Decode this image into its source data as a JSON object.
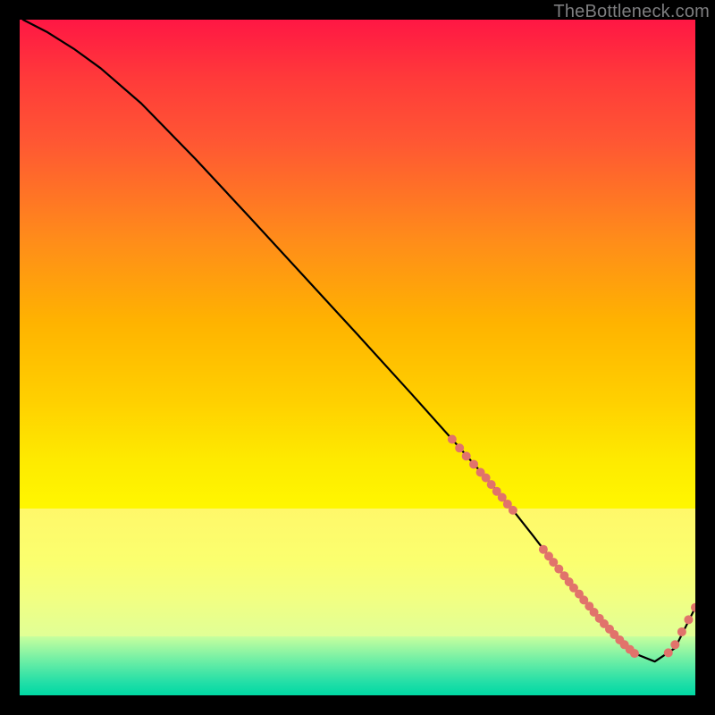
{
  "watermark": "TheBottleneck.com",
  "chart_data": {
    "type": "line",
    "title": "",
    "xlabel": "",
    "ylabel": "",
    "xlim": [
      0,
      100
    ],
    "ylim": [
      0,
      100
    ],
    "grid": false,
    "legend": false,
    "background_bands": [
      {
        "name": "red-yellow-gradient",
        "from_y": 27.7,
        "to_y": 100
      },
      {
        "name": "pale-yellow",
        "from_y": 8.7,
        "to_y": 27.7
      },
      {
        "name": "green-gradient",
        "from_y": 0,
        "to_y": 8.7
      }
    ],
    "series": [
      {
        "name": "bottleneck-curve",
        "color": "#000000",
        "x": [
          0.5,
          4,
          8,
          12,
          18,
          26,
          34,
          42,
          50,
          58,
          64,
          69,
          73,
          76,
          79,
          82,
          85,
          88,
          91,
          94,
          97,
          100
        ],
        "y": [
          100,
          98.2,
          95.7,
          92.8,
          87.6,
          79.4,
          70.8,
          62.1,
          53.4,
          44.6,
          37.9,
          32.2,
          27.4,
          23.6,
          19.7,
          15.9,
          12.3,
          9.0,
          6.2,
          5.0,
          7.0,
          13.0
        ]
      }
    ],
    "dotted_segments": [
      {
        "name": "descent-dots",
        "color": "#e1736b",
        "radius_px": 5,
        "points": [
          [
            64.0,
            37.9
          ],
          [
            65.1,
            36.6
          ],
          [
            66.1,
            35.4
          ],
          [
            67.2,
            34.2
          ],
          [
            68.2,
            33.0
          ],
          [
            69.0,
            32.2
          ],
          [
            69.8,
            31.2
          ],
          [
            70.6,
            30.2
          ],
          [
            71.4,
            29.3
          ],
          [
            72.2,
            28.3
          ],
          [
            73.0,
            27.4
          ]
        ]
      },
      {
        "name": "trough-dots",
        "color": "#e1736b",
        "radius_px": 5,
        "points": [
          [
            77.5,
            21.6
          ],
          [
            78.3,
            20.6
          ],
          [
            79.0,
            19.7
          ],
          [
            79.8,
            18.7
          ],
          [
            80.6,
            17.7
          ],
          [
            81.3,
            16.8
          ],
          [
            82.0,
            15.9
          ],
          [
            82.8,
            15.0
          ],
          [
            83.5,
            14.1
          ],
          [
            84.3,
            13.2
          ],
          [
            85.0,
            12.3
          ],
          [
            85.8,
            11.4
          ],
          [
            86.5,
            10.6
          ],
          [
            87.3,
            9.8
          ],
          [
            88.0,
            9.0
          ],
          [
            88.8,
            8.2
          ],
          [
            89.5,
            7.5
          ],
          [
            90.3,
            6.8
          ],
          [
            91.0,
            6.2
          ]
        ]
      },
      {
        "name": "rise-dots",
        "color": "#e1736b",
        "radius_px": 5,
        "points": [
          [
            96.0,
            6.3
          ],
          [
            97.0,
            7.5
          ],
          [
            98.0,
            9.4
          ],
          [
            99.0,
            11.2
          ],
          [
            100.0,
            13.0
          ]
        ]
      }
    ]
  }
}
